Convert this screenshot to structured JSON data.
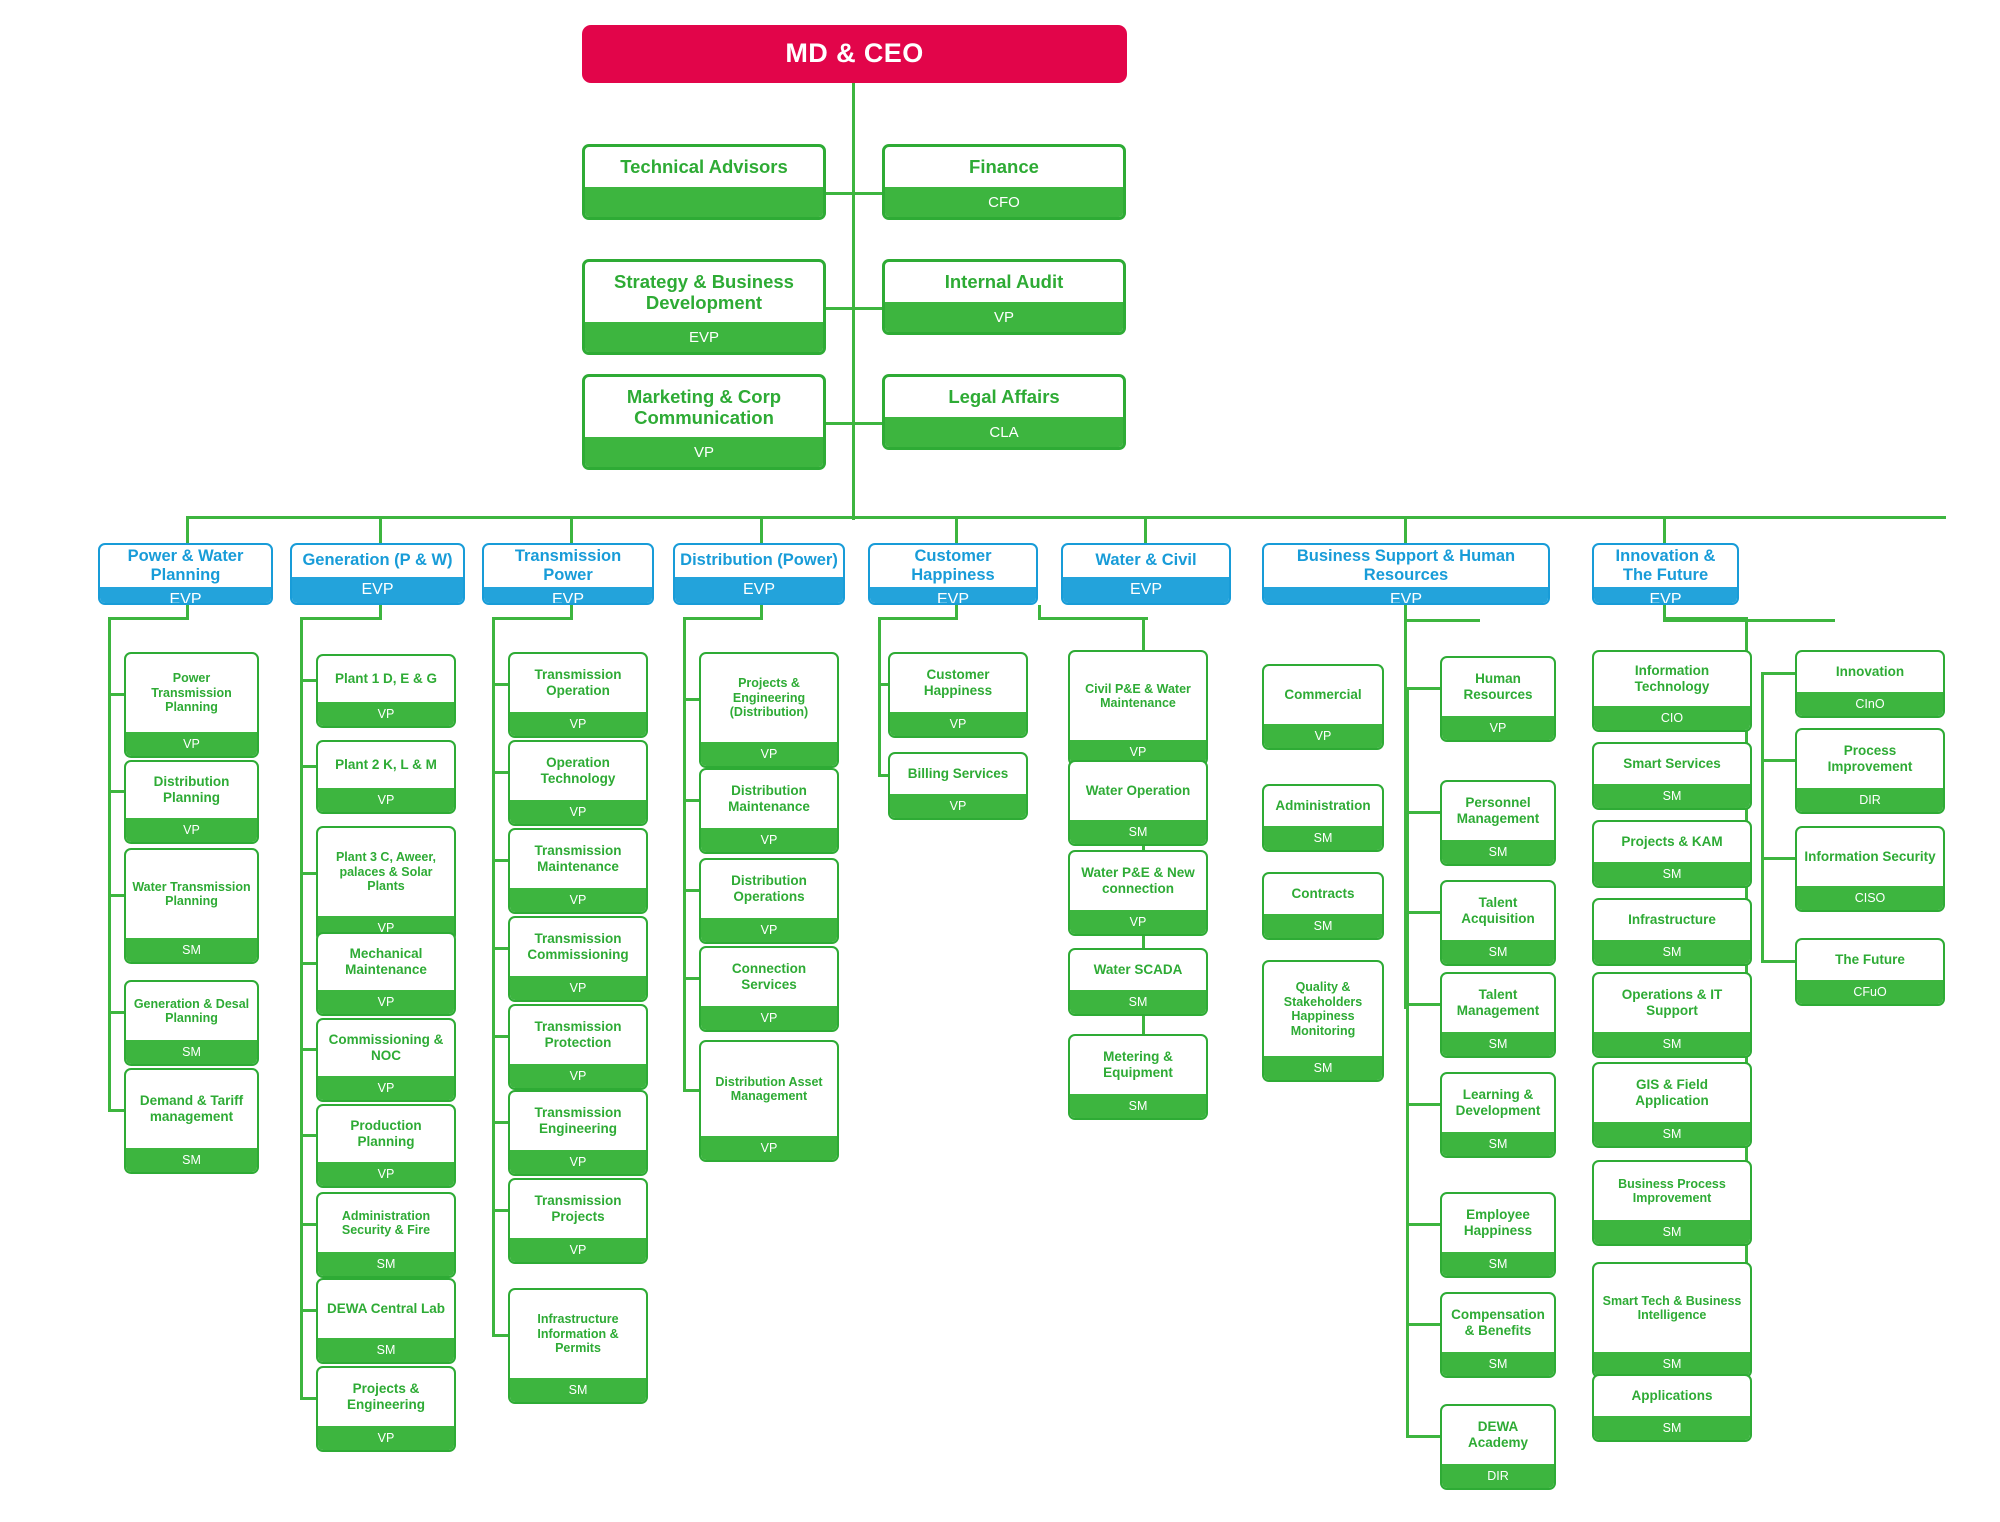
{
  "colors": {
    "root_bg": "#e2054a",
    "division_blue": "#189cd8",
    "unit_green": "#2eab35",
    "role_green": "#3db53f",
    "line_green": "#3db53f"
  },
  "root": {
    "title": "MD & CEO",
    "role": ""
  },
  "staff_left": [
    {
      "title": "Technical Advisors",
      "role": ""
    },
    {
      "title": "Strategy & Business Development",
      "role": "EVP"
    },
    {
      "title": "Marketing & Corp Communication",
      "role": "VP"
    }
  ],
  "staff_right": [
    {
      "title": "Finance",
      "role": "CFO"
    },
    {
      "title": "Internal Audit",
      "role": "VP"
    },
    {
      "title": "Legal Affairs",
      "role": "CLA"
    }
  ],
  "divisions": [
    {
      "title": "Power & Water Planning",
      "role": "EVP",
      "units": [
        {
          "title": "Power Transmission Planning",
          "role": "VP"
        },
        {
          "title": "Distribution Planning",
          "role": "VP"
        },
        {
          "title": "Water Transmission Planning",
          "role": "SM"
        },
        {
          "title": "Generation & Desal Planning",
          "role": "SM"
        },
        {
          "title": "Demand & Tariff management",
          "role": "SM"
        }
      ]
    },
    {
      "title": "Generation (P & W)",
      "role": "EVP",
      "units": [
        {
          "title": "Plant 1 D, E & G",
          "role": "VP"
        },
        {
          "title": "Plant 2 K, L & M",
          "role": "VP"
        },
        {
          "title": "Plant 3 C, Aweer, palaces & Solar Plants",
          "role": "VP"
        },
        {
          "title": "Mechanical Maintenance",
          "role": "VP"
        },
        {
          "title": "Commissioning & NOC",
          "role": "VP"
        },
        {
          "title": "Production Planning",
          "role": "VP"
        },
        {
          "title": "Administration Security & Fire",
          "role": "SM"
        },
        {
          "title": "DEWA Central Lab",
          "role": "SM"
        },
        {
          "title": "Projects & Engineering",
          "role": "VP"
        }
      ]
    },
    {
      "title": "Transmission Power",
      "role": "EVP",
      "units": [
        {
          "title": "Transmission Operation",
          "role": "VP"
        },
        {
          "title": "Operation Technology",
          "role": "VP"
        },
        {
          "title": "Transmission Maintenance",
          "role": "VP"
        },
        {
          "title": "Transmission Commissioning",
          "role": "VP"
        },
        {
          "title": "Transmission Protection",
          "role": "VP"
        },
        {
          "title": "Transmission Engineering",
          "role": "VP"
        },
        {
          "title": "Transmission Projects",
          "role": "VP"
        },
        {
          "title": "Infrastructure Information & Permits",
          "role": "SM"
        }
      ]
    },
    {
      "title": "Distribution (Power)",
      "role": "EVP",
      "units": [
        {
          "title": "Projects & Engineering (Distribution)",
          "role": "VP"
        },
        {
          "title": "Distribution Maintenance",
          "role": "VP"
        },
        {
          "title": "Distribution Operations",
          "role": "VP"
        },
        {
          "title": "Connection Services",
          "role": "VP"
        },
        {
          "title": "Distribution Asset Management",
          "role": "VP"
        }
      ]
    },
    {
      "title": "Customer Happiness",
      "role": "EVP",
      "units": [
        {
          "title": "Customer Happiness",
          "role": "VP"
        },
        {
          "title": "Billing Services",
          "role": "VP"
        }
      ]
    },
    {
      "title": "Water & Civil",
      "role": "EVP",
      "units": [
        {
          "title": "Civil P&E & Water Maintenance",
          "role": "VP"
        },
        {
          "title": "Water Operation",
          "role": "SM"
        },
        {
          "title": "Water P&E & New connection",
          "role": "VP"
        },
        {
          "title": "Water SCADA",
          "role": "SM"
        },
        {
          "title": "Metering & Equipment",
          "role": "SM"
        }
      ]
    },
    {
      "title": "Business Support & Human Resources",
      "role": "EVP",
      "units_left": [
        {
          "title": "Commercial",
          "role": "VP"
        },
        {
          "title": "Administration",
          "role": "SM"
        },
        {
          "title": "Contracts",
          "role": "SM"
        },
        {
          "title": "Quality & Stakeholders Happiness Monitoring",
          "role": "SM"
        }
      ],
      "units_right": [
        {
          "title": "Human Resources",
          "role": "VP"
        },
        {
          "title": "Personnel Management",
          "role": "SM"
        },
        {
          "title": "Talent Acquisition",
          "role": "SM"
        },
        {
          "title": "Talent Management",
          "role": "SM"
        },
        {
          "title": "Learning & Development",
          "role": "SM"
        },
        {
          "title": "Employee Happiness",
          "role": "SM"
        },
        {
          "title": "Compensation & Benefits",
          "role": "SM"
        },
        {
          "title": "DEWA Academy",
          "role": "DIR"
        }
      ]
    },
    {
      "title": "Innovation & The Future",
      "role": "EVP",
      "units_left": [
        {
          "title": "Information Technology",
          "role": "CIO"
        },
        {
          "title": "Smart Services",
          "role": "SM"
        },
        {
          "title": "Projects & KAM",
          "role": "SM"
        },
        {
          "title": "Infrastructure",
          "role": "SM"
        },
        {
          "title": "Operations & IT Support",
          "role": "SM"
        },
        {
          "title": "GIS & Field Application",
          "role": "SM"
        },
        {
          "title": "Business Process Improvement",
          "role": "SM"
        },
        {
          "title": "Smart Tech & Business Intelligence",
          "role": "SM"
        },
        {
          "title": "Applications",
          "role": "SM"
        }
      ],
      "units_right": [
        {
          "title": "Innovation",
          "role": "CInO"
        },
        {
          "title": "Process Improvement",
          "role": "DIR"
        },
        {
          "title": "Information Security",
          "role": "CISO"
        },
        {
          "title": "The Future",
          "role": "CFuO"
        }
      ]
    }
  ]
}
